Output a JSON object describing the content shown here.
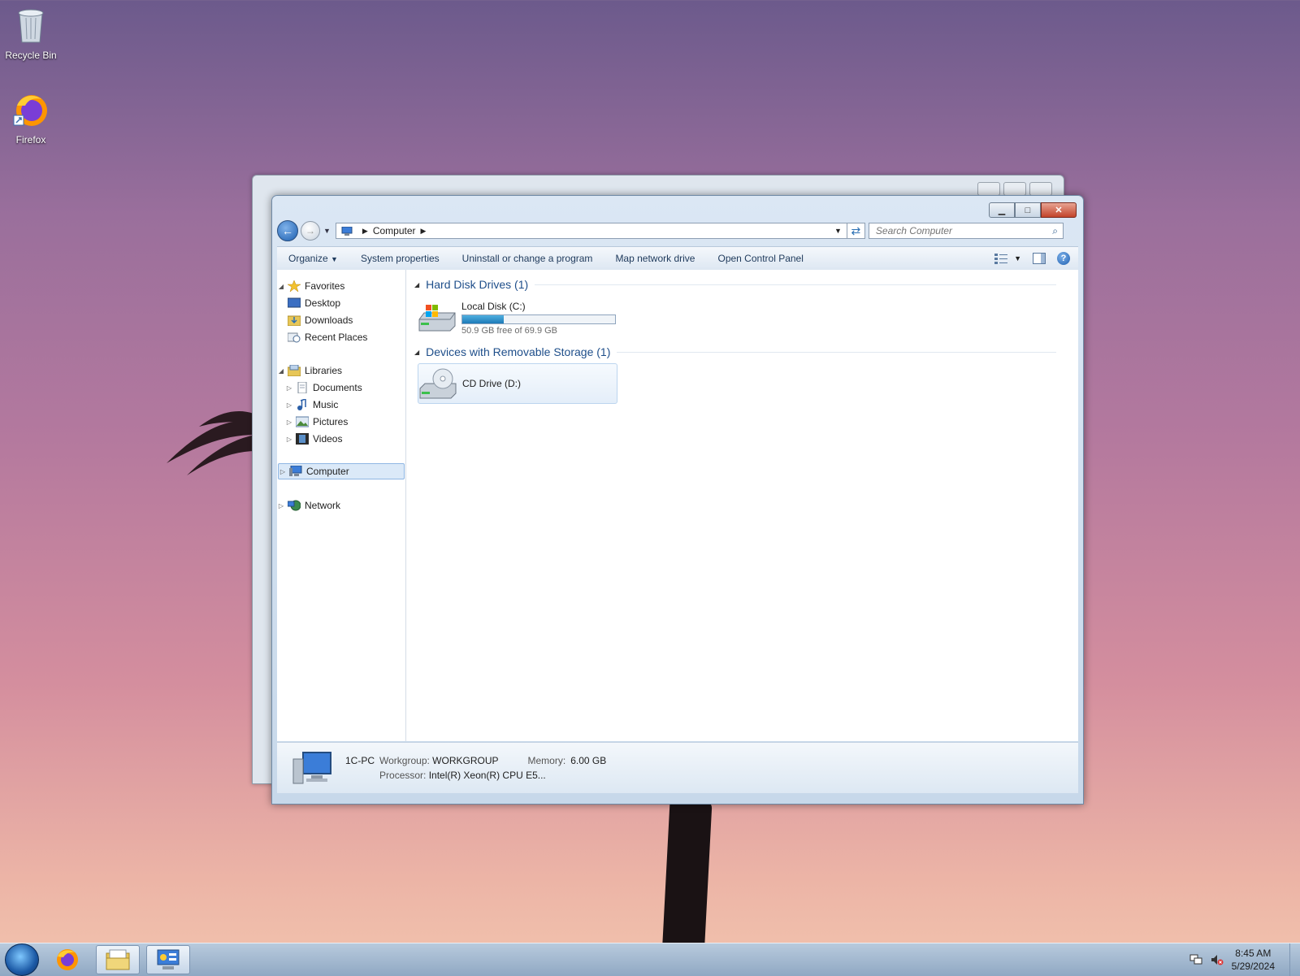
{
  "desktop": {
    "icons": [
      {
        "label": "Recycle Bin",
        "icon": "recycle-bin-icon"
      },
      {
        "label": "Firefox",
        "icon": "firefox-icon"
      }
    ]
  },
  "window": {
    "address": {
      "segments": [
        "Computer"
      ]
    },
    "search": {
      "placeholder": "Search Computer"
    },
    "toolbar": {
      "organize": "Organize",
      "system_properties": "System properties",
      "uninstall": "Uninstall or change a program",
      "map_drive": "Map network drive",
      "control_panel": "Open Control Panel"
    },
    "navpane": {
      "favorites": "Favorites",
      "desktop": "Desktop",
      "downloads": "Downloads",
      "recent": "Recent Places",
      "libraries": "Libraries",
      "documents": "Documents",
      "music": "Music",
      "pictures": "Pictures",
      "videos": "Videos",
      "computer": "Computer",
      "network": "Network"
    },
    "groups": {
      "hdd_header": "Hard Disk Drives (1)",
      "removable_header": "Devices with Removable Storage (1)"
    },
    "drives": {
      "c_name": "Local Disk (C:)",
      "c_free": "50.9 GB free of 69.9 GB",
      "c_used_fraction": 0.272,
      "d_name": "CD Drive (D:)"
    },
    "details": {
      "pc_name": "1C-PC",
      "workgroup_label": "Workgroup:",
      "workgroup_value": "WORKGROUP",
      "memory_label": "Memory:",
      "memory_value": "6.00 GB",
      "processor_label": "Processor:",
      "processor_value": "Intel(R) Xeon(R) CPU E5..."
    }
  },
  "taskbar": {
    "time": "8:45 AM",
    "date": "5/29/2024",
    "apps": [
      "start-orb",
      "firefox",
      "windows-explorer",
      "control-panel"
    ]
  },
  "colors": {
    "accent_link": "#1e4e8a",
    "bar_fill": "#1e7ab8",
    "selected_bg": "#dbe9f8"
  }
}
